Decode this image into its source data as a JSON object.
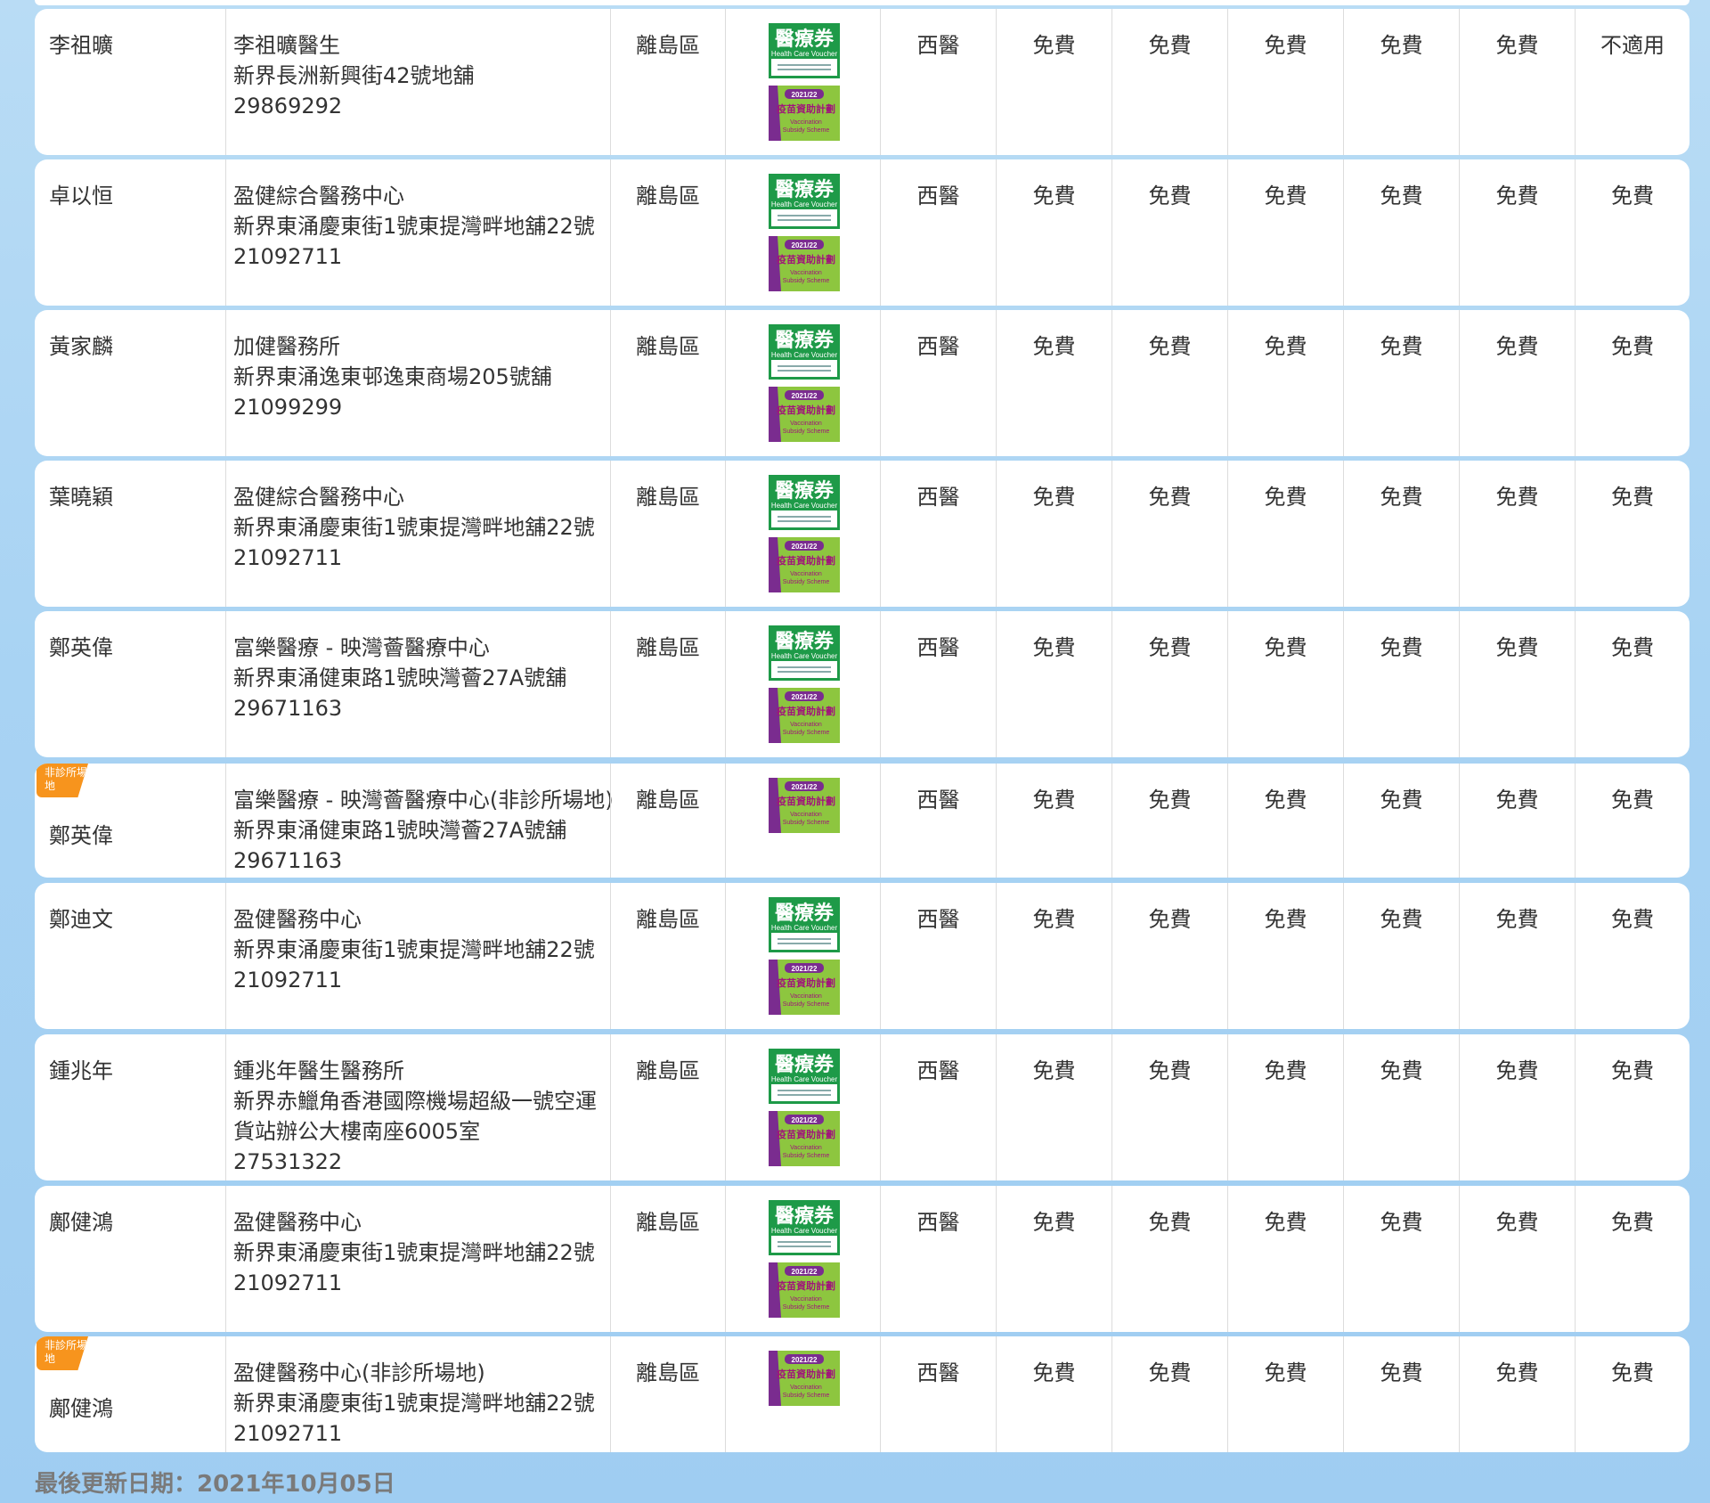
{
  "scheme_labels": {
    "voucher_title": "醫療券",
    "voucher_en": "Health Care Voucher",
    "vaccine_year": "2021/22",
    "vaccine_title": "疫苗資助計劃",
    "vaccine_en1": "Vaccination",
    "vaccine_en2": "Subsidy Scheme"
  },
  "colors": {
    "voucher_green": "#1e9a48",
    "vaccine_lime": "#8dc63f",
    "vaccine_purple": "#7a2c8f",
    "flag_orange": "#f7941d"
  },
  "rows": [
    {
      "flag": "",
      "name": "李祖曠",
      "clinic": "李祖曠醫生",
      "address": [
        "新界長洲新興街42號地舖"
      ],
      "phone": "29869292",
      "district": "離島區",
      "voucher": true,
      "vaccine": true,
      "type": "西醫",
      "v1": "免費",
      "v2": "免費",
      "v3": "免費",
      "v4": "免費",
      "v5": "免費",
      "v6": "不適用"
    },
    {
      "flag": "",
      "name": "卓以恒",
      "clinic": "盈健綜合醫務中心",
      "address": [
        "新界東涌慶東街1號東提灣畔地舖22號"
      ],
      "phone": "21092711",
      "district": "離島區",
      "voucher": true,
      "vaccine": true,
      "type": "西醫",
      "v1": "免費",
      "v2": "免費",
      "v3": "免費",
      "v4": "免費",
      "v5": "免費",
      "v6": "免費"
    },
    {
      "flag": "",
      "name": "黃家麟",
      "clinic": "加健醫務所",
      "address": [
        "新界東涌逸東邨逸東商場205號舖"
      ],
      "phone": "21099299",
      "district": "離島區",
      "voucher": true,
      "vaccine": true,
      "type": "西醫",
      "v1": "免費",
      "v2": "免費",
      "v3": "免費",
      "v4": "免費",
      "v5": "免費",
      "v6": "免費"
    },
    {
      "flag": "",
      "name": "葉曉穎",
      "clinic": "盈健綜合醫務中心",
      "address": [
        "新界東涌慶東街1號東提灣畔地舖22號"
      ],
      "phone": "21092711",
      "district": "離島區",
      "voucher": true,
      "vaccine": true,
      "type": "西醫",
      "v1": "免費",
      "v2": "免費",
      "v3": "免費",
      "v4": "免費",
      "v5": "免費",
      "v6": "免費"
    },
    {
      "flag": "",
      "name": "鄭英偉",
      "clinic": "富樂醫療 - 映灣薈醫療中心",
      "address": [
        "新界東涌健東路1號映灣薈27A號舖"
      ],
      "phone": "29671163",
      "district": "離島區",
      "voucher": true,
      "vaccine": true,
      "type": "西醫",
      "v1": "免費",
      "v2": "免費",
      "v3": "免費",
      "v4": "免費",
      "v5": "免費",
      "v6": "免費"
    },
    {
      "flag": "非診所場地",
      "name": "鄭英偉",
      "clinic": "富樂醫療 - 映灣薈醫療中心(非診所場地)",
      "address": [
        "新界東涌健東路1號映灣薈27A號舖"
      ],
      "phone": "29671163",
      "district": "離島區",
      "voucher": false,
      "vaccine": true,
      "type": "西醫",
      "v1": "免費",
      "v2": "免費",
      "v3": "免費",
      "v4": "免費",
      "v5": "免費",
      "v6": "免費"
    },
    {
      "flag": "",
      "name": "鄭迪文",
      "clinic": "盈健醫務中心",
      "address": [
        "新界東涌慶東街1號東提灣畔地舖22號"
      ],
      "phone": "21092711",
      "district": "離島區",
      "voucher": true,
      "vaccine": true,
      "type": "西醫",
      "v1": "免費",
      "v2": "免費",
      "v3": "免費",
      "v4": "免費",
      "v5": "免費",
      "v6": "免費"
    },
    {
      "flag": "",
      "name": "鍾兆年",
      "clinic": "鍾兆年醫生醫務所",
      "address": [
        "新界赤鱲角香港國際機場超級一號空運",
        "貨站辦公大樓南座6005室"
      ],
      "phone": "27531322",
      "district": "離島區",
      "voucher": true,
      "vaccine": true,
      "type": "西醫",
      "v1": "免費",
      "v2": "免費",
      "v3": "免費",
      "v4": "免費",
      "v5": "免費",
      "v6": "免費"
    },
    {
      "flag": "",
      "name": "鄺健鴻",
      "clinic": "盈健醫務中心",
      "address": [
        "新界東涌慶東街1號東提灣畔地舖22號"
      ],
      "phone": "21092711",
      "district": "離島區",
      "voucher": true,
      "vaccine": true,
      "type": "西醫",
      "v1": "免費",
      "v2": "免費",
      "v3": "免費",
      "v4": "免費",
      "v5": "免費",
      "v6": "免費"
    },
    {
      "flag": "非診所場地",
      "name": "鄺健鴻",
      "clinic": "盈健醫務中心(非診所場地)",
      "address": [
        "新界東涌慶東街1號東提灣畔地舖22號"
      ],
      "phone": "21092711",
      "district": "離島區",
      "voucher": false,
      "vaccine": true,
      "type": "西醫",
      "v1": "免費",
      "v2": "免費",
      "v3": "免費",
      "v4": "免費",
      "v5": "免費",
      "v6": "免費"
    }
  ],
  "footer": {
    "last_updated": "最後更新日期：2021年10月05日"
  }
}
